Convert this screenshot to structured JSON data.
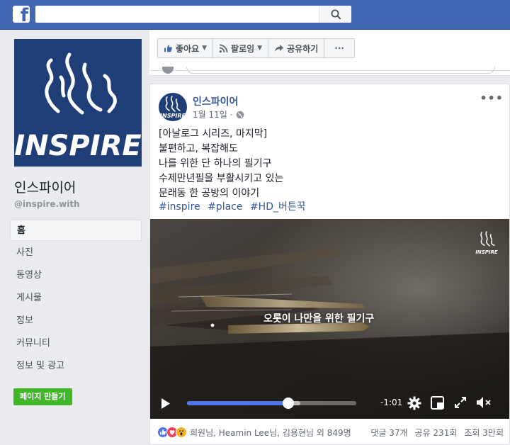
{
  "topbar": {
    "logo": "f",
    "search_placeholder": "",
    "search_icon": "search-icon"
  },
  "page": {
    "name": "인스파이어",
    "handle": "@inspire.with",
    "logo_text": "INSPIRE",
    "nav": [
      "홈",
      "사진",
      "동영상",
      "게시물",
      "정보",
      "커뮤니티",
      "정보 및 광고"
    ],
    "active_nav": 0,
    "create_button": "페이지 만들기"
  },
  "actions": [
    {
      "label": "좋아요",
      "icon": "thumbs-up-icon",
      "caret": true
    },
    {
      "label": "팔로잉",
      "icon": "rss-icon",
      "caret": true
    },
    {
      "label": "공유하기",
      "icon": "share-icon",
      "caret": false
    },
    {
      "label": "···",
      "icon": "",
      "caret": false
    }
  ],
  "post": {
    "author": "인스파이어",
    "date": "1월 11일",
    "separator": "·",
    "privacy_icon": "globe-icon",
    "more": "•••",
    "lines": [
      "[아날로그 시리즈, 마지막]",
      "불편하고, 복잡해도",
      "나를 위한 단 하나의 필기구",
      "수제만년필을 부활시키고 있는",
      "문래동 한 공방의 이야기"
    ],
    "hashtags": [
      "#inspire",
      "#place",
      "#HD_버튼꾹"
    ],
    "video": {
      "caption": "오롯이 나만을 위한 필기구",
      "watermark": "INSPIRE",
      "time_remaining": "-1:01",
      "progress": 0.6,
      "buffered": 0.67
    },
    "footer": {
      "reactions": [
        "like",
        "love",
        "wow"
      ],
      "reactors": "희원님, Heamin Lee님, 김용현님 외 849명",
      "comments": "댓글 37개",
      "shares": "공유 231회",
      "views": "조회 3만회"
    }
  },
  "colors": {
    "brand": "#4267b2",
    "link": "#365899",
    "progress": "#4a76e8",
    "create": "#42b72a",
    "logo_bg": "#1f3e78"
  }
}
